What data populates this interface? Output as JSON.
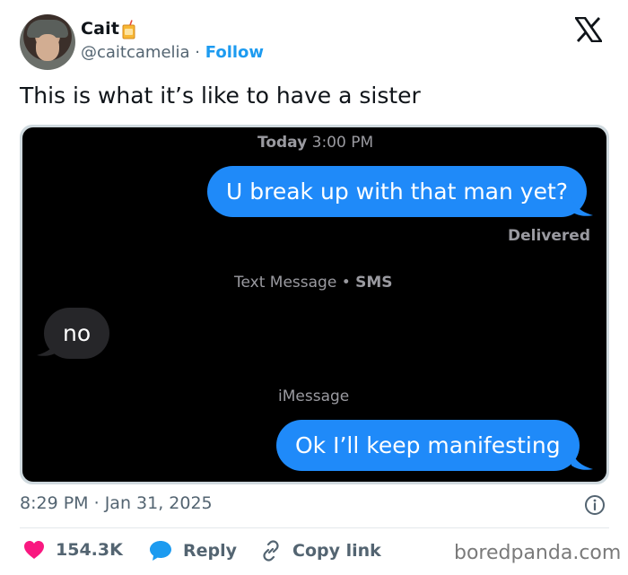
{
  "author": {
    "name": "Cait",
    "name_emoji": "juice-box-emoji",
    "handle": "@caitcamelia",
    "separator": "·",
    "follow_label": "Follow"
  },
  "tweet": {
    "text": "This is what it’s like to have a sister"
  },
  "screenshot": {
    "header_day": "Today",
    "header_time": "3:00 PM",
    "messages": [
      {
        "text": "U break up with that man yet?",
        "direction": "sent"
      },
      {
        "text": "no",
        "direction": "received"
      },
      {
        "text": "Ok I’ll keep manifesting",
        "direction": "sent"
      }
    ],
    "delivered_label": "Delivered",
    "sms_label": "Text Message",
    "sms_sep": "•",
    "sms_type": "SMS",
    "imessage_label": "iMessage"
  },
  "footer": {
    "time": "8:29 PM",
    "sep": "·",
    "date": "Jan 31, 2025",
    "likes": "154.3K",
    "reply_label": "Reply",
    "copy_label": "Copy link",
    "watermark": "boredpanda.com"
  },
  "colors": {
    "sent_bubble": "#1f8af9",
    "received_bubble": "#262629",
    "like_heart": "#f91880",
    "reply_icon": "#1d9bf0",
    "follow": "#1d9bf0"
  },
  "icons": [
    "x-logo-icon",
    "juice-box-emoji",
    "info-icon",
    "heart-icon",
    "reply-bubble-icon",
    "link-icon"
  ]
}
